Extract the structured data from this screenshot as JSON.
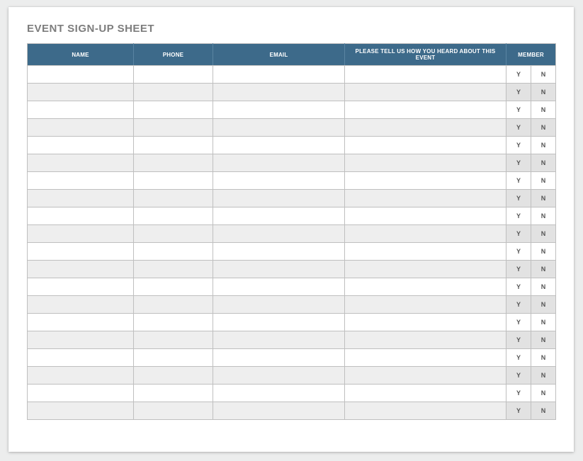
{
  "title": "EVENT SIGN-UP SHEET",
  "headers": {
    "name": "NAME",
    "phone": "PHONE",
    "email": "EMAIL",
    "heard": "PLEASE TELL US HOW YOU HEARD ABOUT THIS EVENT",
    "member": "MEMBER"
  },
  "member_options": {
    "yes": "Y",
    "no": "N"
  },
  "rows": [
    {
      "name": "",
      "phone": "",
      "email": "",
      "heard": "",
      "member": ""
    },
    {
      "name": "",
      "phone": "",
      "email": "",
      "heard": "",
      "member": ""
    },
    {
      "name": "",
      "phone": "",
      "email": "",
      "heard": "",
      "member": ""
    },
    {
      "name": "",
      "phone": "",
      "email": "",
      "heard": "",
      "member": ""
    },
    {
      "name": "",
      "phone": "",
      "email": "",
      "heard": "",
      "member": ""
    },
    {
      "name": "",
      "phone": "",
      "email": "",
      "heard": "",
      "member": ""
    },
    {
      "name": "",
      "phone": "",
      "email": "",
      "heard": "",
      "member": ""
    },
    {
      "name": "",
      "phone": "",
      "email": "",
      "heard": "",
      "member": ""
    },
    {
      "name": "",
      "phone": "",
      "email": "",
      "heard": "",
      "member": ""
    },
    {
      "name": "",
      "phone": "",
      "email": "",
      "heard": "",
      "member": ""
    },
    {
      "name": "",
      "phone": "",
      "email": "",
      "heard": "",
      "member": ""
    },
    {
      "name": "",
      "phone": "",
      "email": "",
      "heard": "",
      "member": ""
    },
    {
      "name": "",
      "phone": "",
      "email": "",
      "heard": "",
      "member": ""
    },
    {
      "name": "",
      "phone": "",
      "email": "",
      "heard": "",
      "member": ""
    },
    {
      "name": "",
      "phone": "",
      "email": "",
      "heard": "",
      "member": ""
    },
    {
      "name": "",
      "phone": "",
      "email": "",
      "heard": "",
      "member": ""
    },
    {
      "name": "",
      "phone": "",
      "email": "",
      "heard": "",
      "member": ""
    },
    {
      "name": "",
      "phone": "",
      "email": "",
      "heard": "",
      "member": ""
    },
    {
      "name": "",
      "phone": "",
      "email": "",
      "heard": "",
      "member": ""
    },
    {
      "name": "",
      "phone": "",
      "email": "",
      "heard": "",
      "member": ""
    }
  ]
}
